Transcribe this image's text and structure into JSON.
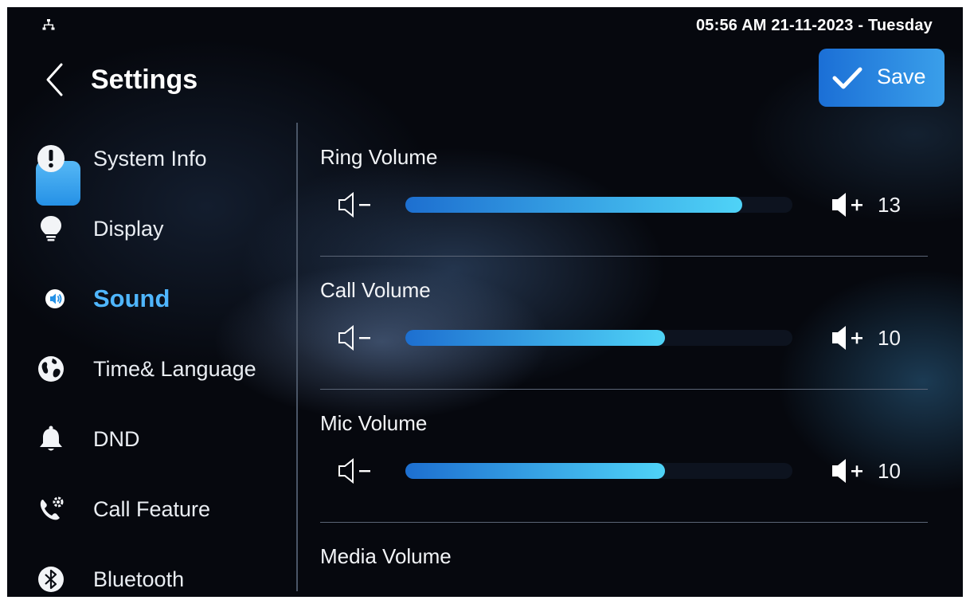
{
  "status_bar": {
    "network_icon": "network-icon",
    "clock": "05:56 AM  21-11-2023 - Tuesday"
  },
  "header": {
    "back_icon": "chevron-left-icon",
    "title": "Settings",
    "save_label": "Save",
    "save_icon": "checkmark-icon"
  },
  "sidebar": {
    "items": [
      {
        "label": "System Info",
        "icon": "info-exclamation-icon"
      },
      {
        "label": "Display",
        "icon": "lightbulb-icon"
      },
      {
        "label": "Sound",
        "icon": "speaker-icon",
        "active": true
      },
      {
        "label": "Time& Language",
        "icon": "globe-icon"
      },
      {
        "label": "DND",
        "icon": "bell-icon"
      },
      {
        "label": "Call Feature",
        "icon": "phone-gear-icon"
      },
      {
        "label": "Bluetooth",
        "icon": "bluetooth-icon"
      }
    ]
  },
  "volumes": [
    {
      "label": "Ring Volume",
      "value": "13",
      "fill_fraction": 0.87
    },
    {
      "label": "Call Volume",
      "value": "10",
      "fill_fraction": 0.67
    },
    {
      "label": "Mic Volume",
      "value": "10",
      "fill_fraction": 0.67
    },
    {
      "label": "Media Volume"
    }
  ],
  "colors": {
    "accent": "#4fb6ff",
    "save_button": "#2587e3",
    "slider_start": "#1d6fd0",
    "slider_end": "#4fd3f7"
  }
}
